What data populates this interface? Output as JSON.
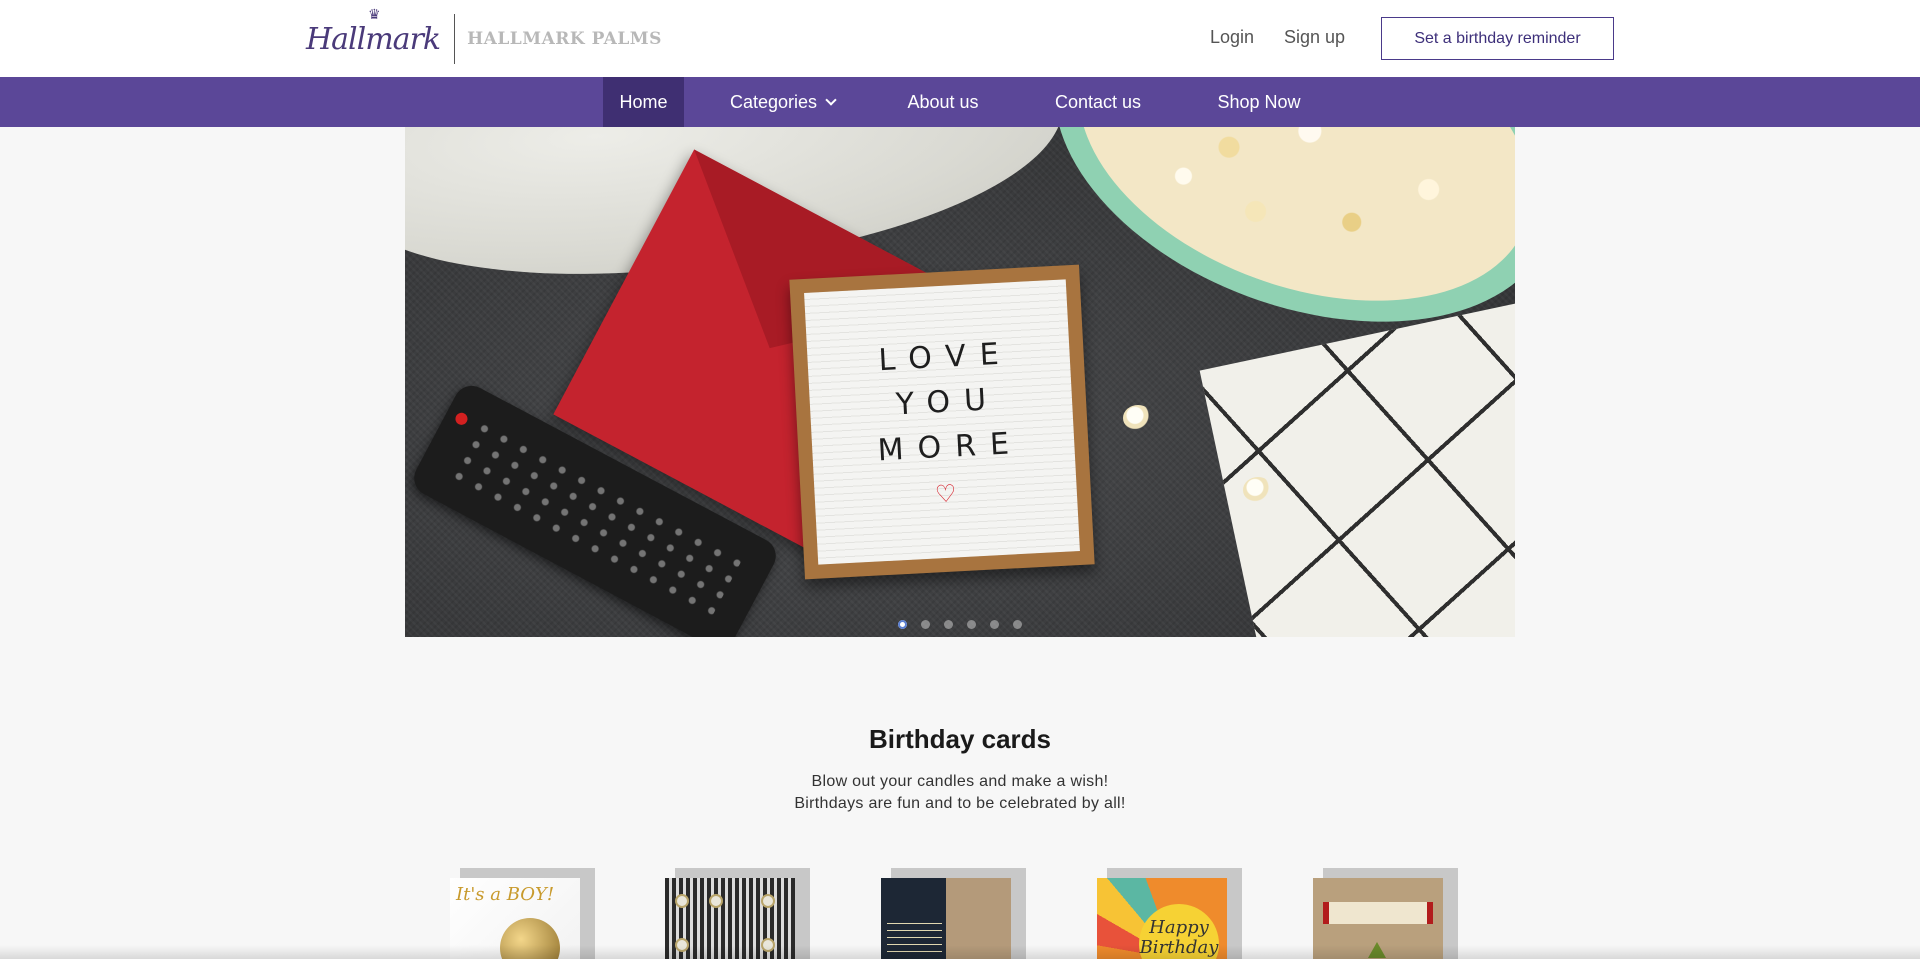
{
  "header": {
    "brand_script": "Hallmark",
    "brand_name": "HALLMARK PALMS",
    "login_label": "Login",
    "signup_label": "Sign up",
    "reminder_label": "Set a birthday reminder"
  },
  "nav": {
    "items": [
      {
        "label": "Home",
        "active": true
      },
      {
        "label": "Categories",
        "has_dropdown": true
      },
      {
        "label": "About us"
      },
      {
        "label": "Contact us"
      },
      {
        "label": "Shop Now"
      }
    ]
  },
  "hero": {
    "board_lines": [
      "LOVE",
      "YOU",
      "MORE"
    ],
    "heart_glyph": "♡",
    "slide_count": 6,
    "active_slide": 1
  },
  "section": {
    "title": "Birthday cards",
    "desc_line1": "Blow out your candles and make a wish!",
    "desc_line2": "Birthdays are fun and to be celebrated by all!"
  },
  "cards": {
    "card1_text": "It's a BOY!",
    "card4_text": "Happy Birthday"
  },
  "colors": {
    "nav_bg": "#5b4798",
    "nav_active_bg": "#3f2f72",
    "brand_purple": "#4a3a7a"
  }
}
